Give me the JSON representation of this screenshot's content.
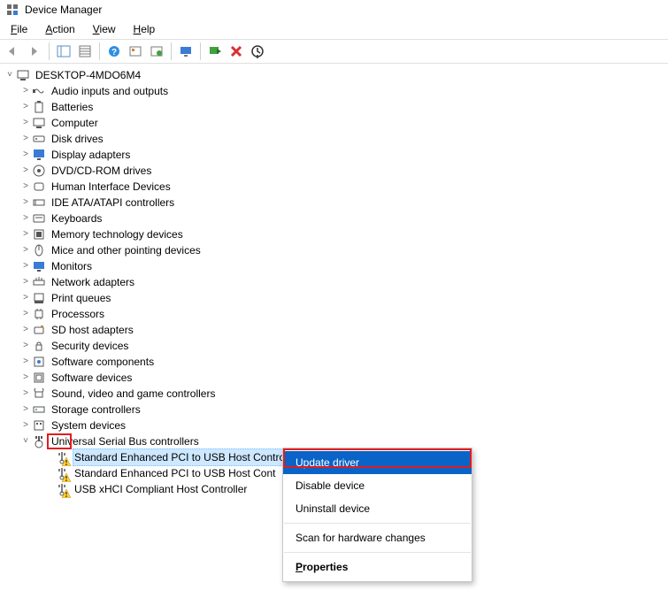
{
  "window": {
    "title": "Device Manager"
  },
  "menu": {
    "file": "File",
    "action": "Action",
    "view": "View",
    "help": "Help"
  },
  "toolbar": {
    "back": "back",
    "forward": "forward",
    "show_hide_tree": "show-hide-console-tree",
    "properties": "properties",
    "help": "help",
    "action_1": "scan",
    "action_2": "update",
    "monitor": "display",
    "enable": "enable-device",
    "disable": "disable-device",
    "uninstall": "uninstall"
  },
  "tree": {
    "root": "DESKTOP-4MDO6M4",
    "categories": [
      {
        "label": "Audio inputs and outputs"
      },
      {
        "label": "Batteries"
      },
      {
        "label": "Computer"
      },
      {
        "label": "Disk drives"
      },
      {
        "label": "Display adapters"
      },
      {
        "label": "DVD/CD-ROM drives"
      },
      {
        "label": "Human Interface Devices"
      },
      {
        "label": "IDE ATA/ATAPI controllers"
      },
      {
        "label": "Keyboards"
      },
      {
        "label": "Memory technology devices"
      },
      {
        "label": "Mice and other pointing devices"
      },
      {
        "label": "Monitors"
      },
      {
        "label": "Network adapters"
      },
      {
        "label": "Print queues"
      },
      {
        "label": "Processors"
      },
      {
        "label": "SD host adapters"
      },
      {
        "label": "Security devices"
      },
      {
        "label": "Software components"
      },
      {
        "label": "Software devices"
      },
      {
        "label": "Sound, video and game controllers"
      },
      {
        "label": "Storage controllers"
      },
      {
        "label": "System devices"
      },
      {
        "label": "Universal Serial Bus controllers",
        "expanded": true
      }
    ],
    "usb_children": [
      {
        "label": "Standard Enhanced PCI to USB Host Controller",
        "warn": true,
        "selected": true
      },
      {
        "label": "Standard Enhanced PCI to USB Host Cont",
        "warn": true
      },
      {
        "label": "USB xHCI Compliant Host Controller",
        "warn": true
      }
    ]
  },
  "context_menu": {
    "update": "Update driver",
    "disable": "Disable device",
    "uninstall": "Uninstall device",
    "scan": "Scan for hardware changes",
    "properties": "Properties"
  }
}
